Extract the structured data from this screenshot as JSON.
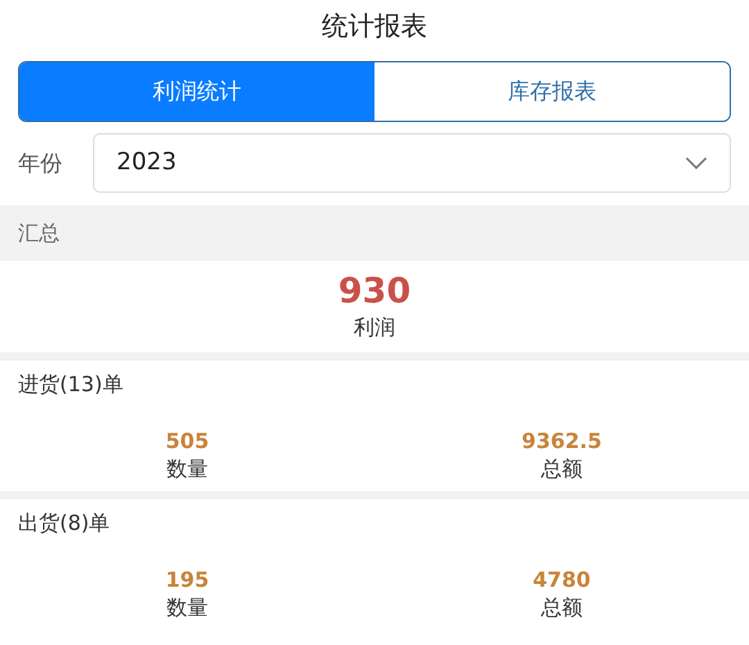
{
  "title": "统计报表",
  "tabs": [
    {
      "label": "利润统计",
      "selected": true
    },
    {
      "label": "库存报表",
      "selected": false
    }
  ],
  "year": {
    "label": "年份",
    "value": "2023"
  },
  "summary": {
    "heading": "汇总",
    "value": "930",
    "label": "利润"
  },
  "sections": [
    {
      "heading": "进货(13)单",
      "stats": [
        {
          "value": "505",
          "label": "数量"
        },
        {
          "value": "9362.5",
          "label": "总额"
        }
      ]
    },
    {
      "heading": "出货(8)单",
      "stats": [
        {
          "value": "195",
          "label": "数量"
        },
        {
          "value": "4780",
          "label": "总额"
        }
      ]
    }
  ]
}
